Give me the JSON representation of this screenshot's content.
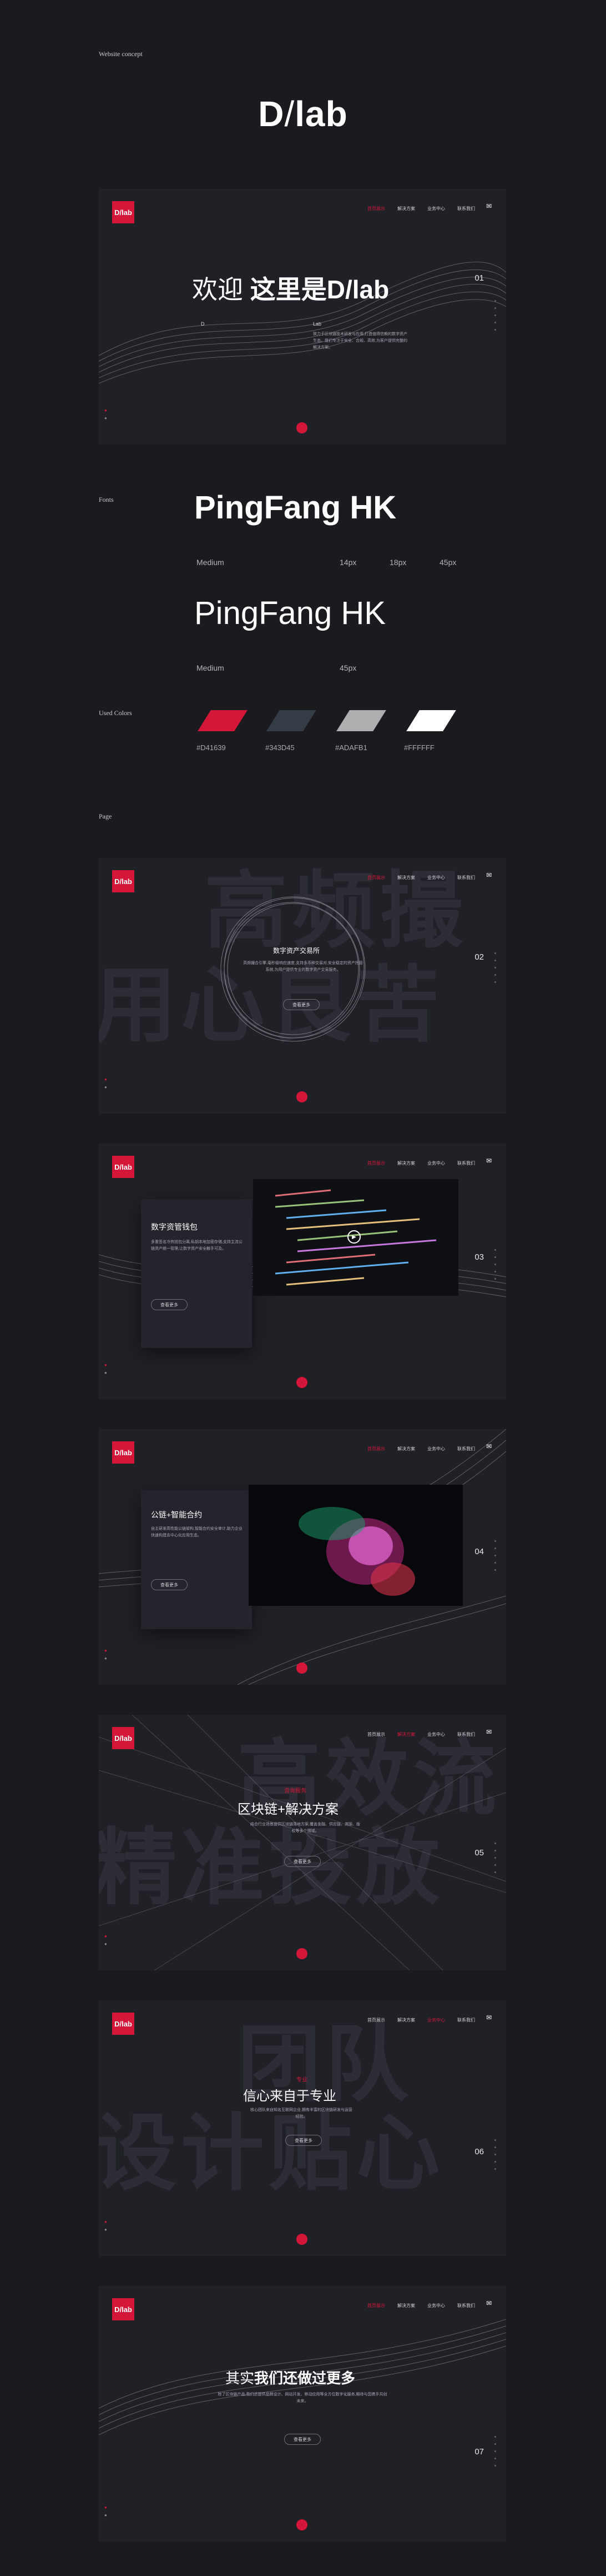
{
  "sections": {
    "concept_label": "Website concept",
    "fonts_label": "Fonts",
    "colors_label": "Used Colors",
    "page_label": "Page"
  },
  "brand": {
    "logo_d": "D",
    "logo_slash": "/",
    "logo_lab": "lab",
    "small_logo": "D/lab"
  },
  "nav": {
    "items": [
      "首页展示",
      "解决方案",
      "业务中心",
      "联系我们"
    ]
  },
  "fonts": {
    "sample1": "PingFang HK",
    "weight1": "Medium",
    "size_a": "14px",
    "size_b": "18px",
    "size_c": "45px",
    "sample2": "PingFang HK",
    "weight2": "Medium",
    "size_d": "45px"
  },
  "colors": [
    {
      "hex": "#D41639",
      "label": "#D41639"
    },
    {
      "hex": "#343D45",
      "label": "#343D45"
    },
    {
      "hex": "#ADAFB1",
      "label": "#ADAFB1"
    },
    {
      "hex": "#FFFFFF",
      "label": "#FFFFFF"
    }
  ],
  "screen1": {
    "title_light": "欢迎 ",
    "title_bold": "这里是D/lab",
    "number": "01",
    "col_left": "D",
    "col_right": "Lab",
    "desc": "致力于区块链技术研发与应用,打造值得信赖的数字资产生态。我们专注于安全、合规、高效,为客户提供完整的解决方案。"
  },
  "screen2": {
    "bg_line1": "高频撮",
    "bg_line2": "用心良苦",
    "title": "数字资产交易所",
    "desc": "高频撮合引擎,毫秒级响应速度,支持多币种交易对,安全稳定的资产托管系统,为用户提供专业的数字资产交易服务。",
    "button": "查看更多",
    "number": "02"
  },
  "screen3": {
    "title": "数字资管钱包",
    "desc": "多重签名冷热钱包分离,私钥本地加密存储,支持主流公链资产统一管理,让数字资产安全触手可及。",
    "button": "查看更多",
    "number": "03"
  },
  "screen4": {
    "title": "公链+智能合约",
    "desc": "自主研发高性能公链架构,智能合约安全审计,助力企业快速构建去中心化应用生态。",
    "button": "查看更多",
    "number": "04"
  },
  "screen5": {
    "bg_line1": "高效流",
    "bg_line2": "精准投放",
    "kicker": "咨询服务",
    "title": "区块链+解决方案",
    "desc": "结合行业场景提供区块链落地方案,覆盖金融、供应链、溯源、版权等多个领域。",
    "button": "查看更多",
    "number": "05"
  },
  "screen6": {
    "bg_line1": "团队",
    "bg_line2": "设计贴心",
    "kicker": "专业",
    "title": "信心来自于专业",
    "desc": "核心团队来自知名互联网企业,拥有丰富的区块链研发与运营经验。",
    "button": "查看更多",
    "number": "06"
  },
  "screen7": {
    "title_light": "其实",
    "title_bold": "我们还做过更多",
    "desc": "除了区块链产品,我们还提供品牌设计、网站开发、移动应用等全方位数字化服务,期待与您携手共创未来。",
    "button": "查看更多",
    "number": "07"
  }
}
